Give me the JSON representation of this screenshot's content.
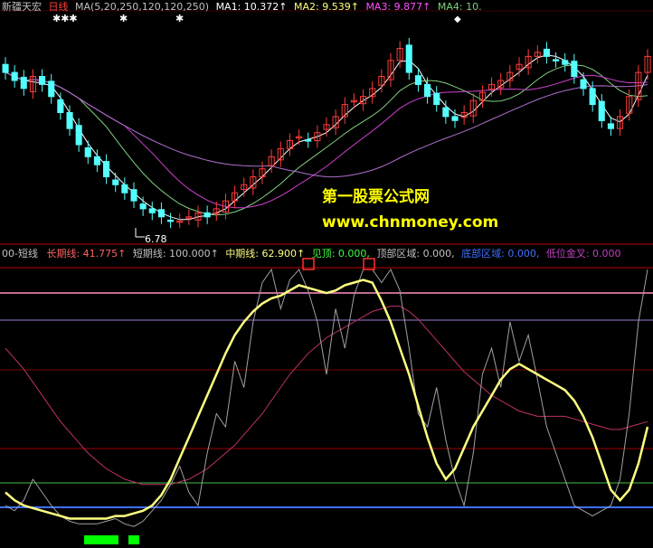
{
  "top_header": {
    "stock_name": "新疆天宏",
    "period": "日线",
    "ma_label": "MA(5,20,250,120,120,250)",
    "ma1": "MA1: 10.372↑",
    "ma2": "MA2: 9.539↑",
    "ma3": "MA3: 9.877↑",
    "ma4": "MA4: 10."
  },
  "low_annotation": "6.78",
  "watermark": {
    "title": "第一股票公式网",
    "url": "www.chnmoney.com"
  },
  "indicator_header": {
    "name": "00-短线",
    "long": "长期线: 41.775↑",
    "short": "短期线: 100.000↑",
    "mid": "中期线: 62.900↑",
    "top": "见顶: 0.000,",
    "top_zone": "顶部区域: 0.000,",
    "bottom_zone": "底部区域: 0.000,",
    "low_cross": "低位金叉: 0.000"
  },
  "colors": {
    "up_candle": "#ff3b3b",
    "down_candle": "#54ffff",
    "ma_white": "#ffffff",
    "ma_green": "#7fd07f",
    "ma_magenta": "#d040d0",
    "ma_purple": "#b070d0",
    "long_line": "#c0306a",
    "short_line": "#a0a0a0",
    "mid_line": "#ffff80",
    "green_bar": "#00ff00",
    "blue_level": "#4070ff"
  },
  "chart_data": [
    {
      "type": "candlestick",
      "ylim": [
        6.5,
        12.0
      ],
      "closes": [
        10.6,
        10.4,
        10.2,
        10.5,
        10.3,
        10.0,
        9.6,
        9.2,
        8.8,
        8.5,
        8.3,
        8.0,
        7.8,
        7.6,
        7.4,
        7.2,
        7.1,
        7.0,
        6.9,
        6.9,
        7.0,
        7.1,
        7.0,
        7.2,
        7.4,
        7.6,
        7.8,
        8.0,
        8.2,
        8.5,
        8.7,
        8.9,
        9.0,
        8.9,
        9.1,
        9.3,
        9.5,
        9.8,
        9.9,
        10.0,
        10.2,
        10.5,
        10.9,
        11.2,
        10.6,
        10.3,
        10.0,
        9.8,
        9.5,
        9.4,
        9.6,
        9.9,
        10.1,
        10.3,
        10.4,
        10.6,
        10.8,
        11.0,
        11.1,
        11.0,
        10.9,
        10.8,
        10.5,
        10.2,
        9.8,
        9.4,
        9.2,
        9.5,
        10.0,
        10.6,
        11.0
      ]
    },
    {
      "type": "line",
      "ylim": [
        0,
        100
      ],
      "levels": [
        90,
        80,
        20,
        10,
        5
      ],
      "series": [
        {
          "name": "长期线",
          "values": [
            70,
            66,
            62,
            57,
            52,
            47,
            42,
            38,
            34,
            30,
            27,
            24,
            22,
            20,
            19,
            18,
            18,
            18,
            18,
            19,
            20,
            22,
            24,
            27,
            30,
            33,
            37,
            41,
            45,
            50,
            55,
            60,
            64,
            68,
            71,
            74,
            76,
            78,
            80,
            82,
            84,
            85,
            86,
            86,
            84,
            81,
            77,
            73,
            69,
            65,
            61,
            58,
            55,
            52,
            50,
            48,
            46,
            45,
            44,
            44,
            44,
            44,
            43,
            42,
            41,
            40,
            39,
            39,
            40,
            41,
            42
          ]
        },
        {
          "name": "短期线",
          "values": [
            10,
            8,
            12,
            20,
            15,
            10,
            6,
            4,
            3,
            3,
            3,
            4,
            5,
            3,
            2,
            4,
            8,
            12,
            18,
            25,
            15,
            10,
            30,
            45,
            40,
            65,
            55,
            80,
            95,
            100,
            85,
            96,
            100,
            92,
            80,
            60,
            85,
            70,
            90,
            100,
            100,
            95,
            100,
            92,
            70,
            45,
            40,
            55,
            35,
            20,
            10,
            30,
            60,
            70,
            55,
            80,
            65,
            75,
            58,
            40,
            30,
            20,
            10,
            8,
            6,
            8,
            10,
            20,
            45,
            80,
            100
          ]
        },
        {
          "name": "中期线",
          "values": [
            15,
            12,
            10,
            9,
            8,
            7,
            6,
            5,
            5,
            5,
            5,
            5,
            6,
            6,
            7,
            8,
            10,
            14,
            20,
            28,
            36,
            44,
            52,
            60,
            68,
            75,
            80,
            84,
            87,
            89,
            90,
            92,
            94,
            93,
            92,
            91,
            92,
            94,
            95,
            96,
            95,
            88,
            80,
            70,
            60,
            48,
            36,
            26,
            20,
            24,
            32,
            40,
            46,
            52,
            58,
            62,
            64,
            62,
            60,
            58,
            56,
            54,
            50,
            44,
            36,
            26,
            16,
            12,
            16,
            26,
            40
          ]
        }
      ],
      "bar_signal_days": [
        12,
        13,
        14,
        15,
        18
      ]
    }
  ]
}
